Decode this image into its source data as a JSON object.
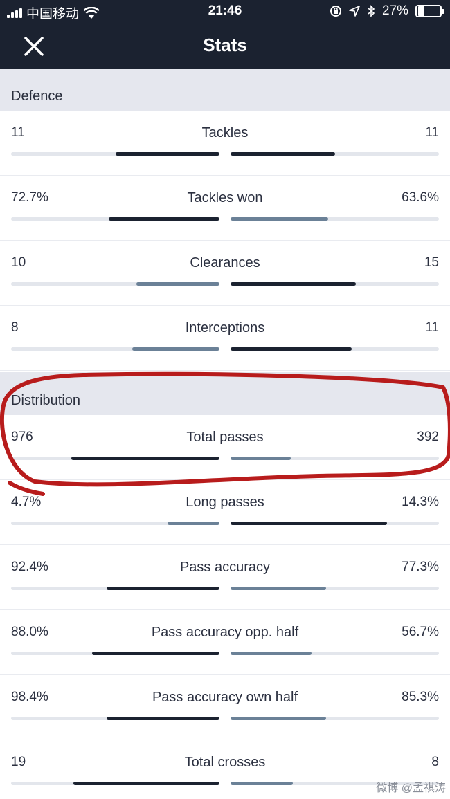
{
  "status_bar": {
    "carrier": "中国移动",
    "time": "21:46",
    "battery": "27%",
    "battery_level": 0.27
  },
  "header": {
    "title": "Stats"
  },
  "colors": {
    "dark": "#1b2230",
    "muted": "#6b8197",
    "track": "#e3e6ec",
    "annotation": "#b81c1c"
  },
  "sections": [
    {
      "title": "Defence",
      "rows": [
        {
          "label": "Tackles",
          "left": "11",
          "right": "11",
          "left_frac": 0.5,
          "right_frac": 0.5,
          "left_color": "dark",
          "right_color": "dark"
        },
        {
          "label": "Tackles won",
          "left": "72.7%",
          "right": "63.6%",
          "left_frac": 0.53,
          "right_frac": 0.47,
          "left_color": "dark",
          "right_color": "muted"
        },
        {
          "label": "Clearances",
          "left": "10",
          "right": "15",
          "left_frac": 0.4,
          "right_frac": 0.6,
          "left_color": "muted",
          "right_color": "dark"
        },
        {
          "label": "Interceptions",
          "left": "8",
          "right": "11",
          "left_frac": 0.42,
          "right_frac": 0.58,
          "left_color": "muted",
          "right_color": "dark"
        }
      ]
    },
    {
      "title": "Distribution",
      "rows": [
        {
          "label": "Total passes",
          "left": "976",
          "right": "392",
          "left_frac": 0.71,
          "right_frac": 0.29,
          "left_color": "dark",
          "right_color": "muted"
        },
        {
          "label": "Long passes",
          "left": "4.7%",
          "right": "14.3%",
          "left_frac": 0.25,
          "right_frac": 0.75,
          "left_color": "muted",
          "right_color": "dark"
        },
        {
          "label": "Pass accuracy",
          "left": "92.4%",
          "right": "77.3%",
          "left_frac": 0.54,
          "right_frac": 0.46,
          "left_color": "dark",
          "right_color": "muted"
        },
        {
          "label": "Pass accuracy opp. half",
          "left": "88.0%",
          "right": "56.7%",
          "left_frac": 0.61,
          "right_frac": 0.39,
          "left_color": "dark",
          "right_color": "muted"
        },
        {
          "label": "Pass accuracy own half",
          "left": "98.4%",
          "right": "85.3%",
          "left_frac": 0.54,
          "right_frac": 0.46,
          "left_color": "dark",
          "right_color": "muted"
        },
        {
          "label": "Total crosses",
          "left": "19",
          "right": "8",
          "left_frac": 0.7,
          "right_frac": 0.3,
          "left_color": "dark",
          "right_color": "muted"
        }
      ]
    }
  ],
  "watermark": "微博 @孟祺涛"
}
